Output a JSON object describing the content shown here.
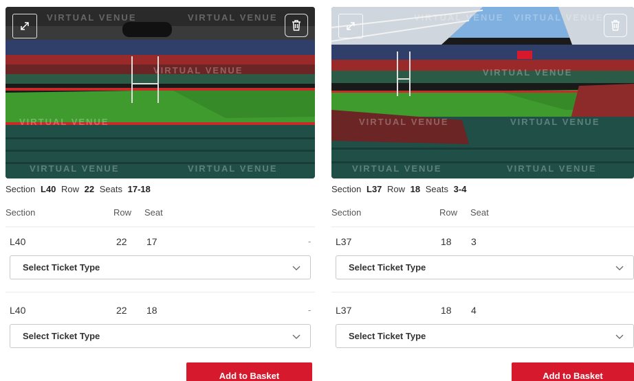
{
  "watermark_text": "VIRTUAL VENUE",
  "colors": {
    "accent": "#d7192d",
    "pitch": "#3f9b2d",
    "seats": "#1f4f46"
  },
  "columns": {
    "section": "Section",
    "row": "Row",
    "seat": "Seat"
  },
  "select_placeholder": "Select Ticket Type",
  "add_to_basket": "Add to Basket",
  "panels": [
    {
      "summary": {
        "section_label": "Section",
        "section": "L40",
        "row_label": "Row",
        "row": "22",
        "seats_label": "Seats",
        "seats": "17-18"
      },
      "tickets": [
        {
          "section": "L40",
          "row": "22",
          "seat": "17",
          "dash": "-"
        },
        {
          "section": "L40",
          "row": "22",
          "seat": "18",
          "dash": "-"
        }
      ]
    },
    {
      "summary": {
        "section_label": "Section",
        "section": "L37",
        "row_label": "Row",
        "row": "18",
        "seats_label": "Seats",
        "seats": "3-4"
      },
      "tickets": [
        {
          "section": "L37",
          "row": "18",
          "seat": "3",
          "dash": "-"
        },
        {
          "section": "L37",
          "row": "18",
          "seat": "4",
          "dash": "-"
        }
      ]
    }
  ]
}
